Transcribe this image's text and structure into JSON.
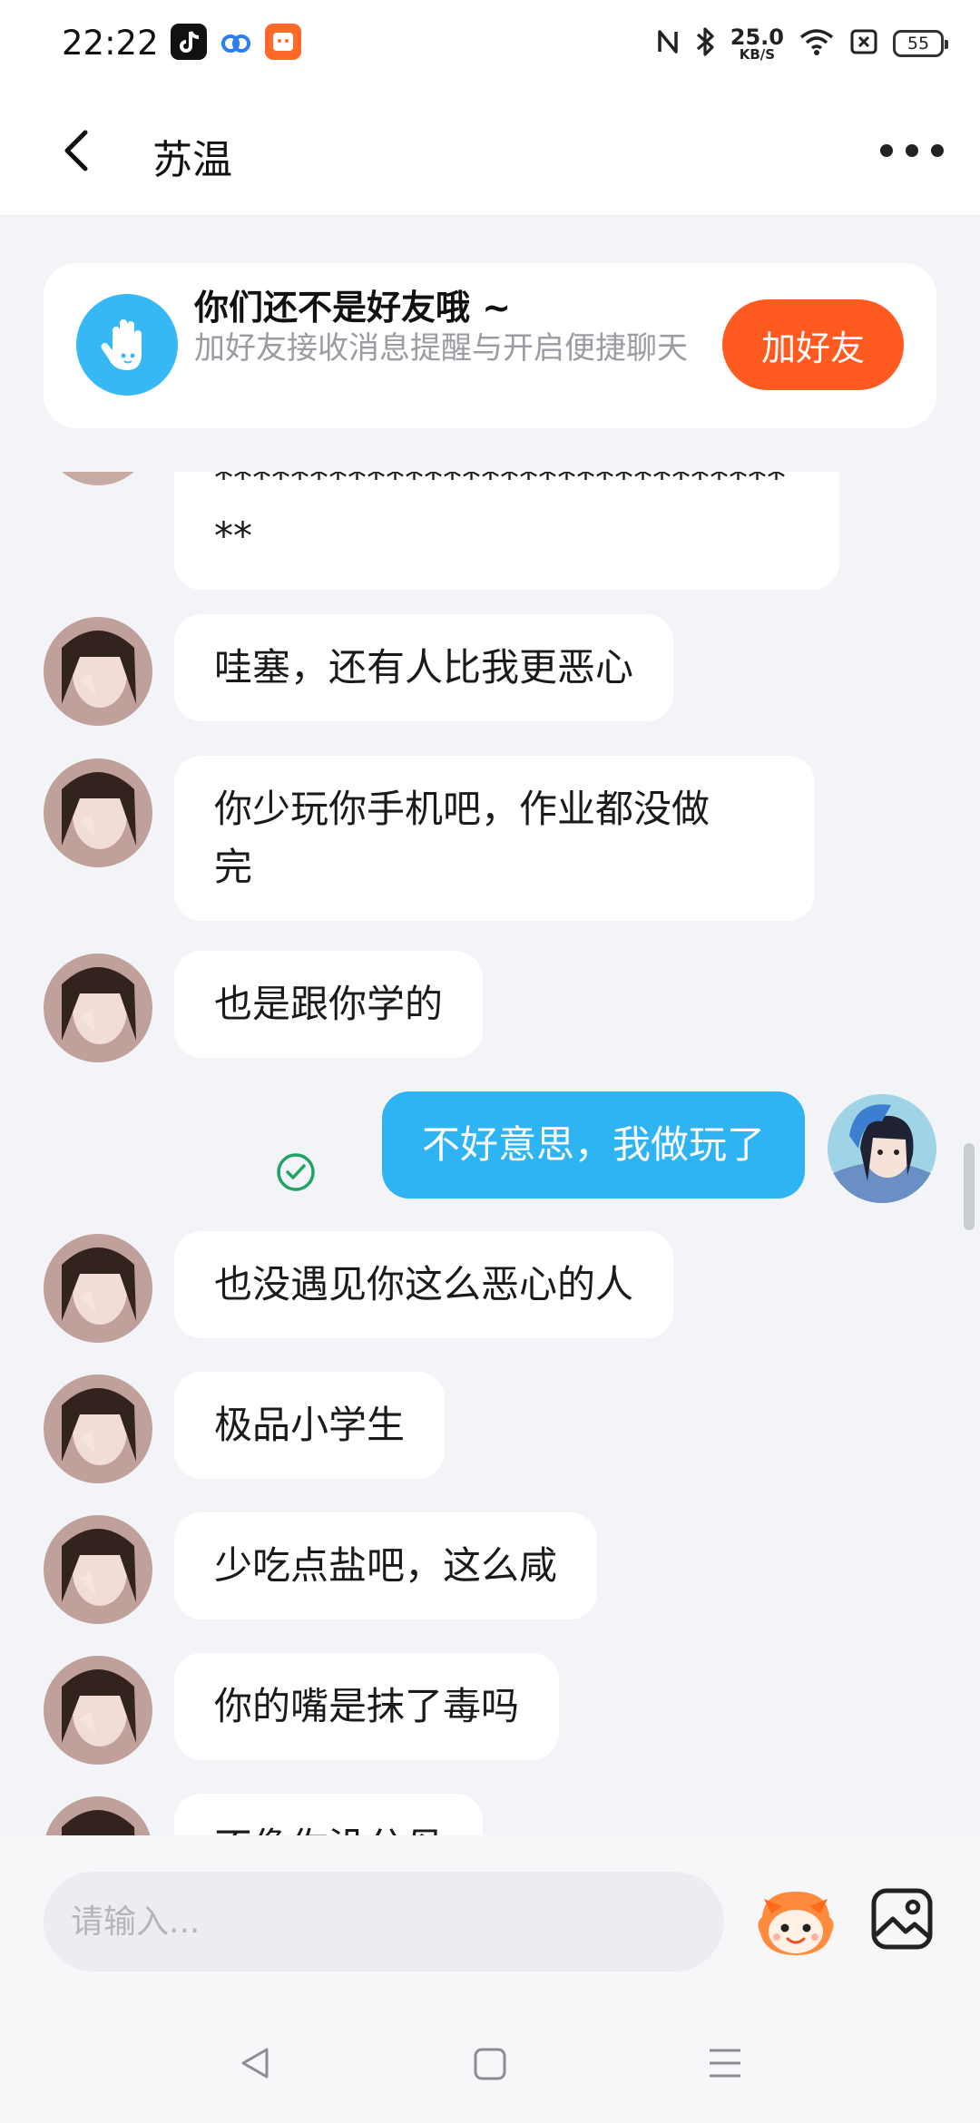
{
  "status_bar": {
    "time": "22:22",
    "net_speed_value": "25.0",
    "net_speed_unit": "KB/S",
    "battery": "55",
    "icons": [
      "tiktok-icon",
      "cloud-app-icon",
      "shop-app-icon",
      "nfc-icon",
      "bluetooth-icon",
      "wifi-icon",
      "no-sim-icon",
      "battery-icon"
    ]
  },
  "header": {
    "title": "苏温",
    "back_icon": "chevron-left-icon",
    "more_icon": "more-dots-icon"
  },
  "friend_banner": {
    "title": "你们还不是好友哦 ~",
    "description": "加好友接收消息提醒与开启便捷聊天",
    "button_label": "加好友",
    "icon": "hand-icon"
  },
  "messages": [
    {
      "sender": "other",
      "text": "******************************\n**",
      "partial": true
    },
    {
      "sender": "other",
      "text": "哇塞，还有人比我更恶心"
    },
    {
      "sender": "other",
      "text": "你少玩你手机吧，作业都没做\n完"
    },
    {
      "sender": "other",
      "text": "也是跟你学的"
    },
    {
      "sender": "self",
      "text": "不好意思，我做玩了",
      "status": "read"
    },
    {
      "sender": "other",
      "text": "也没遇见你这么恶心的人"
    },
    {
      "sender": "other",
      "text": "极品小学生"
    },
    {
      "sender": "other",
      "text": "少吃点盐吧，这么咸"
    },
    {
      "sender": "other",
      "text": "你的嘴是抹了毒吗"
    },
    {
      "sender": "other",
      "text": "不像你没分母",
      "partial": true
    }
  ],
  "input_bar": {
    "placeholder": "请输入...",
    "emoji_icon": "emoji-mascot-icon",
    "image_icon": "image-icon"
  },
  "nav_bar": {
    "icons": [
      "nav-back-icon",
      "nav-home-icon",
      "nav-menu-icon"
    ]
  },
  "colors": {
    "accent_blue": "#2eb4f3",
    "add_friend_orange": "#ff5a1f",
    "chat_background": "#f3f4f8",
    "read_check_green": "#1fa463"
  }
}
